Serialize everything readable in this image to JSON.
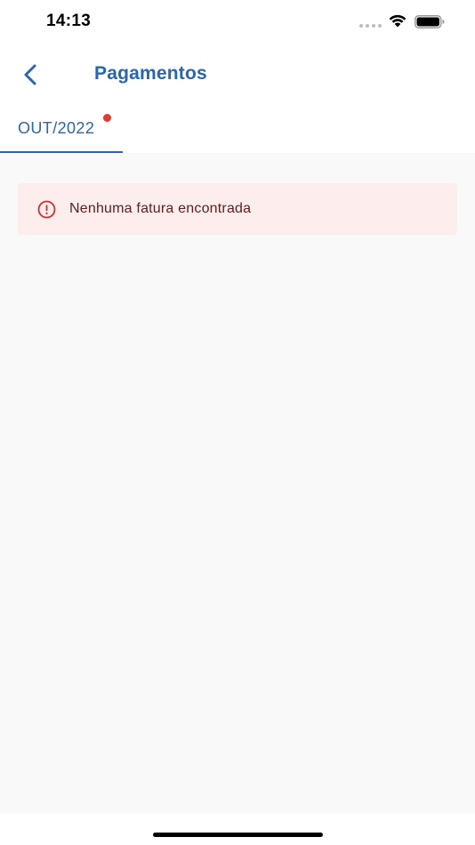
{
  "status_bar": {
    "time": "14:13",
    "icons": [
      "signal-icon",
      "wifi-icon",
      "battery-icon"
    ]
  },
  "header": {
    "title": "Pagamentos",
    "back_icon": "chevron-left-icon"
  },
  "tabs": [
    {
      "label": "OUT/2022",
      "active": true,
      "has_notification": true
    }
  ],
  "alert": {
    "icon": "error-outline-icon",
    "message": "Nenhuma fatura encontrada"
  },
  "colors": {
    "primary": "#2a66ae",
    "notification": "#e53935",
    "alert_bg": "#fdeded",
    "alert_text": "#5f2120",
    "alert_icon": "#d32f2f",
    "content_bg": "#f9f9f9"
  }
}
